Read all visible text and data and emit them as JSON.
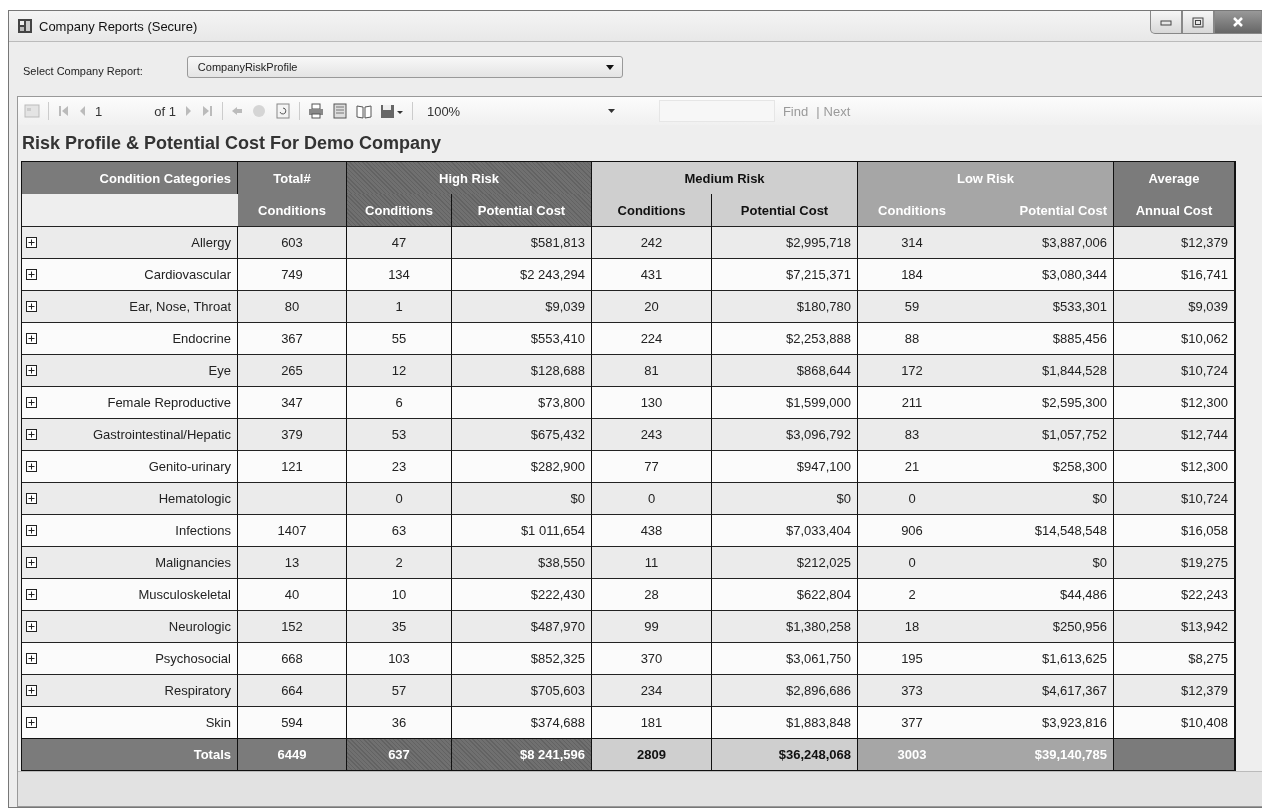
{
  "window": {
    "title": "Company Reports (Secure)"
  },
  "selector": {
    "label": "Select Company Report:",
    "value": "CompanyRiskProfile"
  },
  "toolbar": {
    "page": "1",
    "page_count": "of 1",
    "zoom": "100%",
    "find": "Find",
    "separator": "|",
    "next": "Next"
  },
  "report": {
    "title": "Risk Profile & Potential Cost For Demo Company"
  },
  "table": {
    "category_label": "Condition Categories",
    "groups": [
      {
        "label": "Total#",
        "kind": "dark",
        "columns": [
          "Conditions"
        ]
      },
      {
        "label": "High Risk",
        "kind": "hatched",
        "columns": [
          "Conditions",
          "Potential Cost"
        ]
      },
      {
        "label": "Medium Risk",
        "kind": "light",
        "columns": [
          "Conditions",
          "Potential Cost"
        ]
      },
      {
        "label": "Low Risk",
        "kind": "mid",
        "columns": [
          "Conditions",
          "Potential Cost"
        ]
      },
      {
        "label": "Average",
        "kind": "dark",
        "columns": [
          "Annual Cost"
        ]
      }
    ],
    "rows": [
      {
        "category": "Allergy",
        "expanded": false,
        "total": "603",
        "high_conditions": "47",
        "high_cost": "$581,813",
        "medium_conditions": "242",
        "medium_cost": "$2,995,718",
        "low_conditions": "314",
        "low_cost": "$3,887,006",
        "average": "$12,379"
      },
      {
        "category": "Cardiovascular",
        "expanded": false,
        "total": "749",
        "high_conditions": "134",
        "high_cost": "$2 243,294",
        "medium_conditions": "431",
        "medium_cost": "$7,215,371",
        "low_conditions": "184",
        "low_cost": "$3,080,344",
        "average": "$16,741"
      },
      {
        "category": "Ear, Nose, Throat",
        "expanded": false,
        "total": "80",
        "high_conditions": "1",
        "high_cost": "$9,039",
        "medium_conditions": "20",
        "medium_cost": "$180,780",
        "low_conditions": "59",
        "low_cost": "$533,301",
        "average": "$9,039"
      },
      {
        "category": "Endocrine",
        "expanded": false,
        "total": "367",
        "high_conditions": "55",
        "high_cost": "$553,410",
        "medium_conditions": "224",
        "medium_cost": "$2,253,888",
        "low_conditions": "88",
        "low_cost": "$885,456",
        "average": "$10,062"
      },
      {
        "category": "Eye",
        "expanded": false,
        "total": "265",
        "high_conditions": "12",
        "high_cost": "$128,688",
        "medium_conditions": "81",
        "medium_cost": "$868,644",
        "low_conditions": "172",
        "low_cost": "$1,844,528",
        "average": "$10,724"
      },
      {
        "category": "Female Reproductive",
        "expanded": false,
        "total": "347",
        "high_conditions": "6",
        "high_cost": "$73,800",
        "medium_conditions": "130",
        "medium_cost": "$1,599,000",
        "low_conditions": "211",
        "low_cost": "$2,595,300",
        "average": "$12,300"
      },
      {
        "category": "Gastrointestinal/Hepatic",
        "expanded": false,
        "total": "379",
        "high_conditions": "53",
        "high_cost": "$675,432",
        "medium_conditions": "243",
        "medium_cost": "$3,096,792",
        "low_conditions": "83",
        "low_cost": "$1,057,752",
        "average": "$12,744"
      },
      {
        "category": "Genito-urinary",
        "expanded": false,
        "total": "121",
        "high_conditions": "23",
        "high_cost": "$282,900",
        "medium_conditions": "77",
        "medium_cost": "$947,100",
        "low_conditions": "21",
        "low_cost": "$258,300",
        "average": "$12,300"
      },
      {
        "category": "Hematologic",
        "expanded": false,
        "high_conditions": "0",
        "high_cost": "$0",
        "medium_conditions": "0",
        "medium_cost": "$0",
        "low_conditions": "0",
        "low_cost": "$0",
        "average": "$10,724"
      },
      {
        "category": "Infections",
        "expanded": false,
        "total": "1407",
        "high_conditions": "63",
        "high_cost": "$1 011,654",
        "medium_conditions": "438",
        "medium_cost": "$7,033,404",
        "low_conditions": "906",
        "low_cost": "$14,548,548",
        "average": "$16,058"
      },
      {
        "category": "Malignancies",
        "expanded": false,
        "total": "13",
        "high_conditions": "2",
        "high_cost": "$38,550",
        "medium_conditions": "11",
        "medium_cost": "$212,025",
        "low_conditions": "0",
        "low_cost": "$0",
        "average": "$19,275"
      },
      {
        "category": "Musculoskeletal",
        "expanded": false,
        "total": "40",
        "high_conditions": "10",
        "high_cost": "$222,430",
        "medium_conditions": "28",
        "medium_cost": "$622,804",
        "low_conditions": "2",
        "low_cost": "$44,486",
        "average": "$22,243"
      },
      {
        "category": "Neurologic",
        "expanded": false,
        "total": "152",
        "high_conditions": "35",
        "high_cost": "$487,970",
        "medium_conditions": "99",
        "medium_cost": "$1,380,258",
        "low_conditions": "18",
        "low_cost": "$250,956",
        "average": "$13,942"
      },
      {
        "category": "Psychosocial",
        "expanded": false,
        "total": "668",
        "high_conditions": "103",
        "high_cost": "$852,325",
        "medium_conditions": "370",
        "medium_cost": "$3,061,750",
        "low_conditions": "195",
        "low_cost": "$1,613,625",
        "average": "$8,275"
      },
      {
        "category": "Respiratory",
        "expanded": false,
        "total": "664",
        "high_conditions": "57",
        "high_cost": "$705,603",
        "medium_conditions": "234",
        "medium_cost": "$2,896,686",
        "low_conditions": "373",
        "low_cost": "$4,617,367",
        "average": "$12,379"
      },
      {
        "category": "Skin",
        "expanded": false,
        "total": "594",
        "high_conditions": "36",
        "high_cost": "$374,688",
        "medium_conditions": "181",
        "medium_cost": "$1,883,848",
        "low_conditions": "377",
        "low_cost": "$3,923,816",
        "average": "$10,408"
      }
    ],
    "totals": {
      "category": "Totals",
      "total": "6449",
      "high_conditions": "637",
      "high_cost": "$8 241,596",
      "medium_conditions": "2809",
      "medium_cost": "$36,248,068",
      "low_conditions": "3003",
      "low_cost": "$39,140,785"
    }
  }
}
